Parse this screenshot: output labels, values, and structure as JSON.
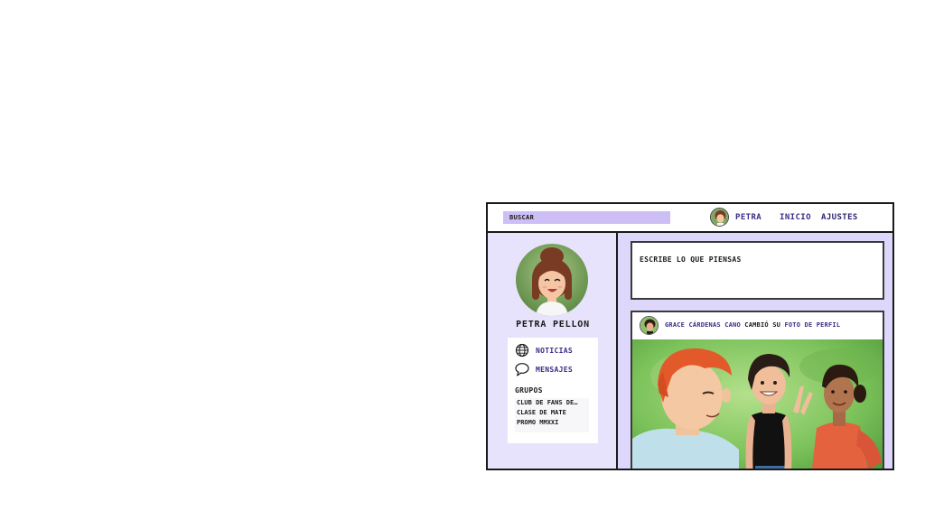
{
  "topbar": {
    "search_placeholder": "BUSCAR",
    "user_label": "PETRA",
    "home_label": "INICIO",
    "settings_label": "AJUSTES"
  },
  "sidebar": {
    "profile_name": "PETRA PELLON",
    "menu": [
      {
        "label": "NOTICIAS",
        "icon": "globe-icon"
      },
      {
        "label": "MENSAJES",
        "icon": "speech-bubble-icon"
      }
    ],
    "groups_title": "GRUPOS",
    "groups": [
      "CLUB DE FANS DE…",
      "CLASE DE MATE",
      "PROMO MMXXI"
    ]
  },
  "main": {
    "composer_placeholder": "ESCRIBE LO QUE PIENSAS",
    "post": {
      "author": "GRACE CÁRDENAS CANO",
      "action": "CAMBIÓ SU",
      "object": "FOTO DE PERFIL"
    }
  },
  "colors": {
    "accent": "#3a2e86",
    "search_bg": "#cdbff6",
    "page_bg": "#ddd7fb"
  }
}
